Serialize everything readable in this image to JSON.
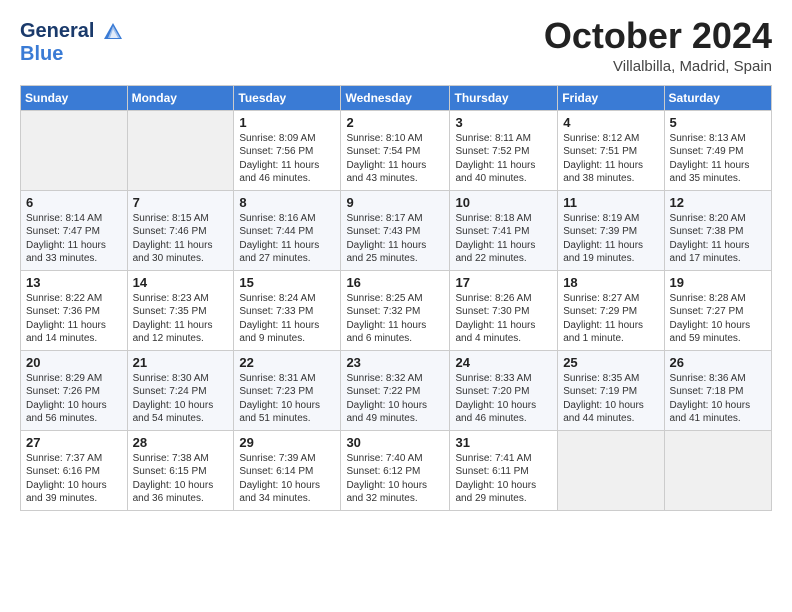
{
  "header": {
    "logo_line1": "General",
    "logo_line2": "Blue",
    "month": "October 2024",
    "location": "Villalbilla, Madrid, Spain"
  },
  "days_of_week": [
    "Sunday",
    "Monday",
    "Tuesday",
    "Wednesday",
    "Thursday",
    "Friday",
    "Saturday"
  ],
  "weeks": [
    [
      {
        "day": "",
        "sunrise": "",
        "sunset": "",
        "daylight": ""
      },
      {
        "day": "",
        "sunrise": "",
        "sunset": "",
        "daylight": ""
      },
      {
        "day": "1",
        "sunrise": "Sunrise: 8:09 AM",
        "sunset": "Sunset: 7:56 PM",
        "daylight": "Daylight: 11 hours and 46 minutes."
      },
      {
        "day": "2",
        "sunrise": "Sunrise: 8:10 AM",
        "sunset": "Sunset: 7:54 PM",
        "daylight": "Daylight: 11 hours and 43 minutes."
      },
      {
        "day": "3",
        "sunrise": "Sunrise: 8:11 AM",
        "sunset": "Sunset: 7:52 PM",
        "daylight": "Daylight: 11 hours and 40 minutes."
      },
      {
        "day": "4",
        "sunrise": "Sunrise: 8:12 AM",
        "sunset": "Sunset: 7:51 PM",
        "daylight": "Daylight: 11 hours and 38 minutes."
      },
      {
        "day": "5",
        "sunrise": "Sunrise: 8:13 AM",
        "sunset": "Sunset: 7:49 PM",
        "daylight": "Daylight: 11 hours and 35 minutes."
      }
    ],
    [
      {
        "day": "6",
        "sunrise": "Sunrise: 8:14 AM",
        "sunset": "Sunset: 7:47 PM",
        "daylight": "Daylight: 11 hours and 33 minutes."
      },
      {
        "day": "7",
        "sunrise": "Sunrise: 8:15 AM",
        "sunset": "Sunset: 7:46 PM",
        "daylight": "Daylight: 11 hours and 30 minutes."
      },
      {
        "day": "8",
        "sunrise": "Sunrise: 8:16 AM",
        "sunset": "Sunset: 7:44 PM",
        "daylight": "Daylight: 11 hours and 27 minutes."
      },
      {
        "day": "9",
        "sunrise": "Sunrise: 8:17 AM",
        "sunset": "Sunset: 7:43 PM",
        "daylight": "Daylight: 11 hours and 25 minutes."
      },
      {
        "day": "10",
        "sunrise": "Sunrise: 8:18 AM",
        "sunset": "Sunset: 7:41 PM",
        "daylight": "Daylight: 11 hours and 22 minutes."
      },
      {
        "day": "11",
        "sunrise": "Sunrise: 8:19 AM",
        "sunset": "Sunset: 7:39 PM",
        "daylight": "Daylight: 11 hours and 19 minutes."
      },
      {
        "day": "12",
        "sunrise": "Sunrise: 8:20 AM",
        "sunset": "Sunset: 7:38 PM",
        "daylight": "Daylight: 11 hours and 17 minutes."
      }
    ],
    [
      {
        "day": "13",
        "sunrise": "Sunrise: 8:22 AM",
        "sunset": "Sunset: 7:36 PM",
        "daylight": "Daylight: 11 hours and 14 minutes."
      },
      {
        "day": "14",
        "sunrise": "Sunrise: 8:23 AM",
        "sunset": "Sunset: 7:35 PM",
        "daylight": "Daylight: 11 hours and 12 minutes."
      },
      {
        "day": "15",
        "sunrise": "Sunrise: 8:24 AM",
        "sunset": "Sunset: 7:33 PM",
        "daylight": "Daylight: 11 hours and 9 minutes."
      },
      {
        "day": "16",
        "sunrise": "Sunrise: 8:25 AM",
        "sunset": "Sunset: 7:32 PM",
        "daylight": "Daylight: 11 hours and 6 minutes."
      },
      {
        "day": "17",
        "sunrise": "Sunrise: 8:26 AM",
        "sunset": "Sunset: 7:30 PM",
        "daylight": "Daylight: 11 hours and 4 minutes."
      },
      {
        "day": "18",
        "sunrise": "Sunrise: 8:27 AM",
        "sunset": "Sunset: 7:29 PM",
        "daylight": "Daylight: 11 hours and 1 minute."
      },
      {
        "day": "19",
        "sunrise": "Sunrise: 8:28 AM",
        "sunset": "Sunset: 7:27 PM",
        "daylight": "Daylight: 10 hours and 59 minutes."
      }
    ],
    [
      {
        "day": "20",
        "sunrise": "Sunrise: 8:29 AM",
        "sunset": "Sunset: 7:26 PM",
        "daylight": "Daylight: 10 hours and 56 minutes."
      },
      {
        "day": "21",
        "sunrise": "Sunrise: 8:30 AM",
        "sunset": "Sunset: 7:24 PM",
        "daylight": "Daylight: 10 hours and 54 minutes."
      },
      {
        "day": "22",
        "sunrise": "Sunrise: 8:31 AM",
        "sunset": "Sunset: 7:23 PM",
        "daylight": "Daylight: 10 hours and 51 minutes."
      },
      {
        "day": "23",
        "sunrise": "Sunrise: 8:32 AM",
        "sunset": "Sunset: 7:22 PM",
        "daylight": "Daylight: 10 hours and 49 minutes."
      },
      {
        "day": "24",
        "sunrise": "Sunrise: 8:33 AM",
        "sunset": "Sunset: 7:20 PM",
        "daylight": "Daylight: 10 hours and 46 minutes."
      },
      {
        "day": "25",
        "sunrise": "Sunrise: 8:35 AM",
        "sunset": "Sunset: 7:19 PM",
        "daylight": "Daylight: 10 hours and 44 minutes."
      },
      {
        "day": "26",
        "sunrise": "Sunrise: 8:36 AM",
        "sunset": "Sunset: 7:18 PM",
        "daylight": "Daylight: 10 hours and 41 minutes."
      }
    ],
    [
      {
        "day": "27",
        "sunrise": "Sunrise: 7:37 AM",
        "sunset": "Sunset: 6:16 PM",
        "daylight": "Daylight: 10 hours and 39 minutes."
      },
      {
        "day": "28",
        "sunrise": "Sunrise: 7:38 AM",
        "sunset": "Sunset: 6:15 PM",
        "daylight": "Daylight: 10 hours and 36 minutes."
      },
      {
        "day": "29",
        "sunrise": "Sunrise: 7:39 AM",
        "sunset": "Sunset: 6:14 PM",
        "daylight": "Daylight: 10 hours and 34 minutes."
      },
      {
        "day": "30",
        "sunrise": "Sunrise: 7:40 AM",
        "sunset": "Sunset: 6:12 PM",
        "daylight": "Daylight: 10 hours and 32 minutes."
      },
      {
        "day": "31",
        "sunrise": "Sunrise: 7:41 AM",
        "sunset": "Sunset: 6:11 PM",
        "daylight": "Daylight: 10 hours and 29 minutes."
      },
      {
        "day": "",
        "sunrise": "",
        "sunset": "",
        "daylight": ""
      },
      {
        "day": "",
        "sunrise": "",
        "sunset": "",
        "daylight": ""
      }
    ]
  ]
}
